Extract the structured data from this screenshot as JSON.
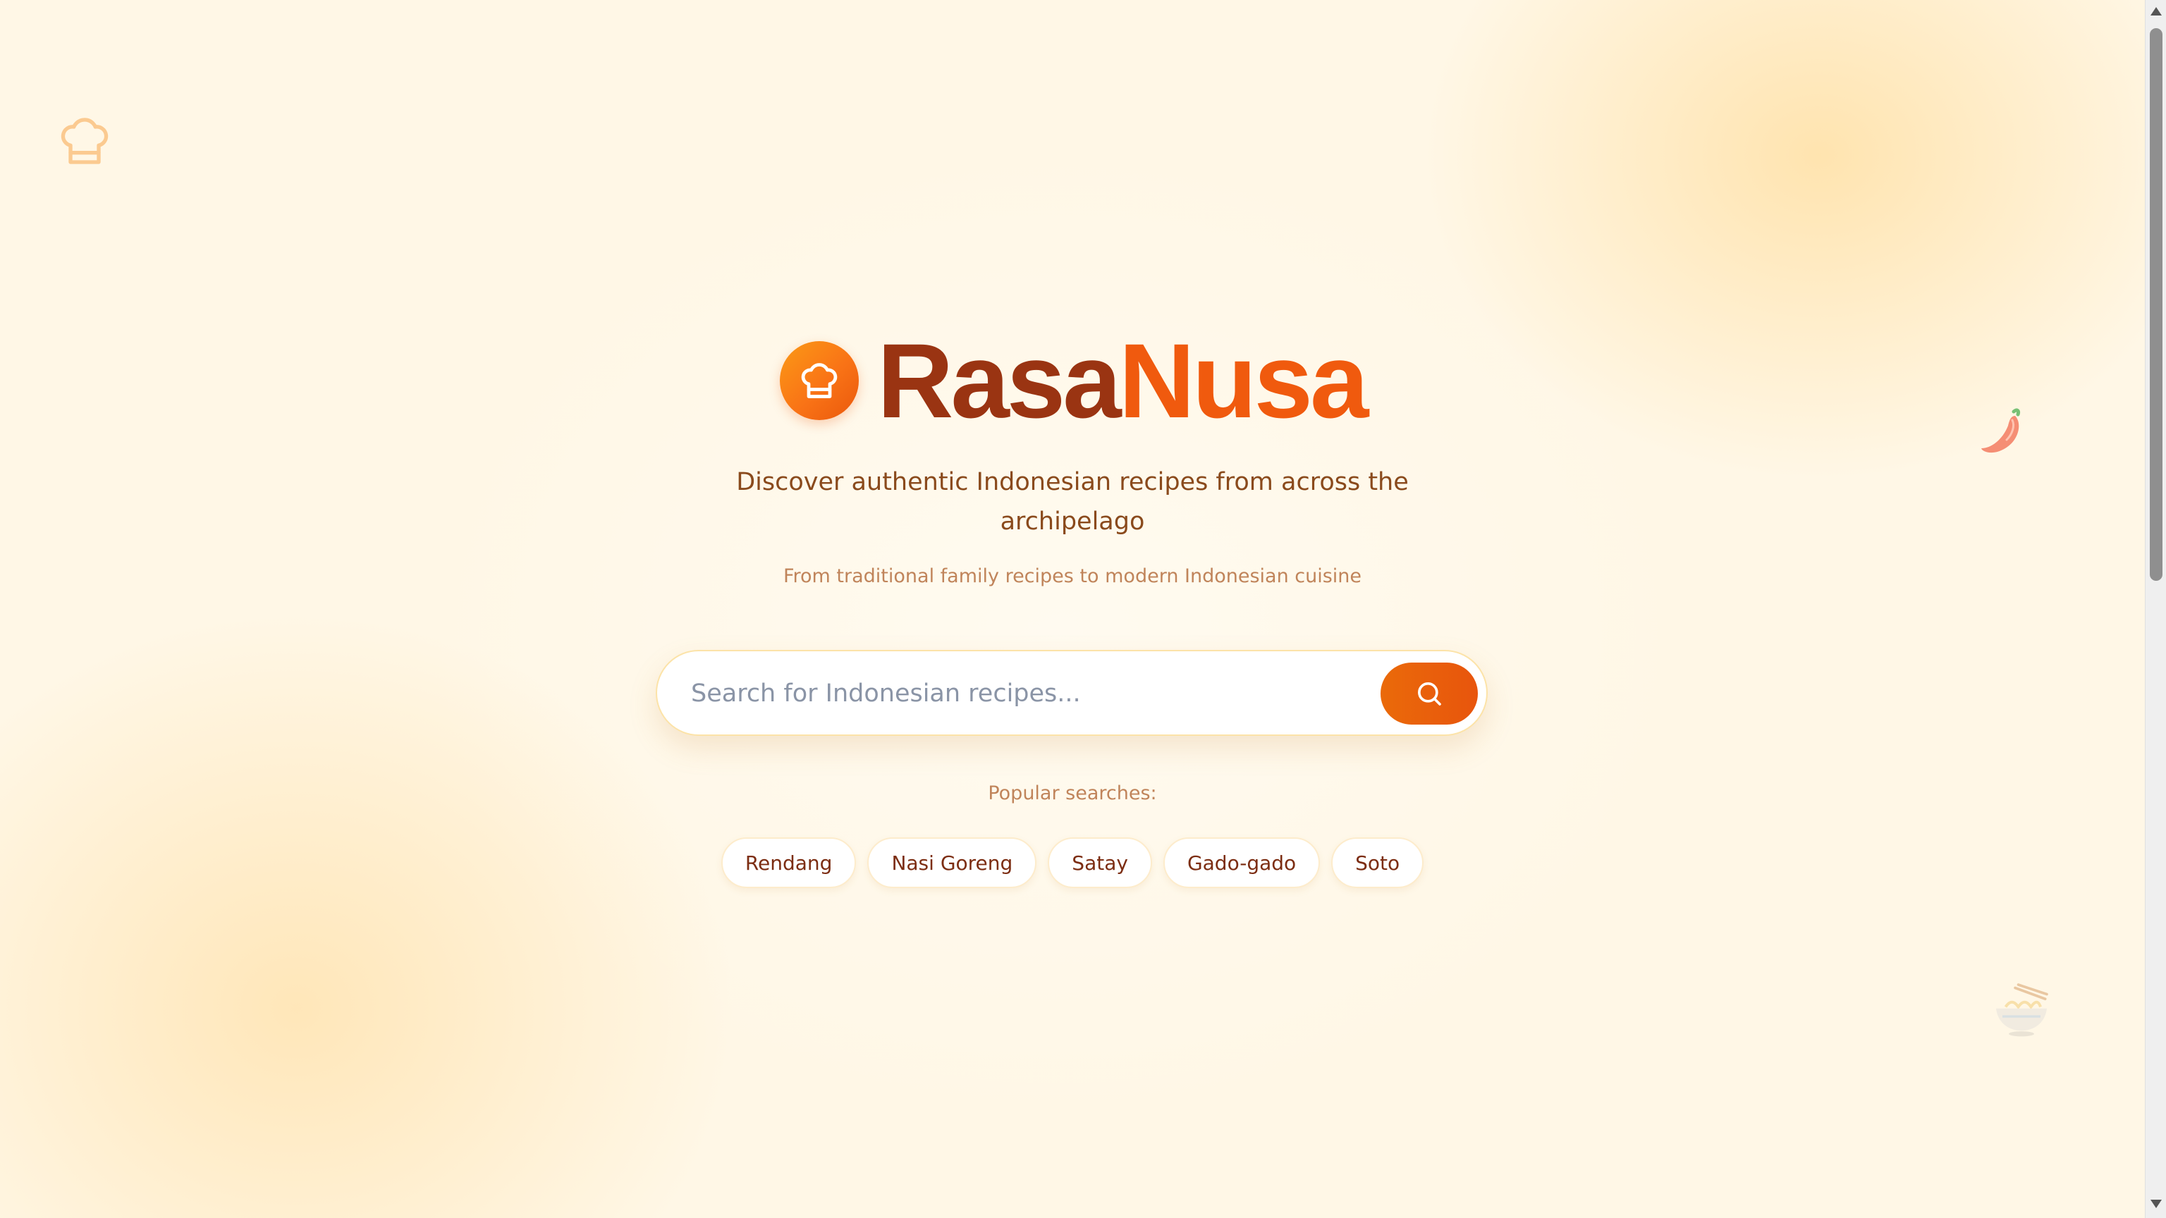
{
  "brand": {
    "name_part1": "Rasa",
    "name_part2": "Nusa",
    "logo_icon": "chef-hat-icon",
    "colors": {
      "rasa": "#9a3412",
      "nusa": "#f05a0e",
      "accent": "#ea580c"
    }
  },
  "hero": {
    "tagline": "Discover authentic Indonesian recipes from across the archipelago",
    "subtagline": "From traditional family recipes to modern Indonesian cuisine"
  },
  "search": {
    "placeholder": "Search for Indonesian recipes...",
    "value": "",
    "button_icon": "search-icon"
  },
  "popular": {
    "label": "Popular searches:",
    "items": [
      "Rendang",
      "Nasi Goreng",
      "Satay",
      "Gado-gado",
      "Soto"
    ]
  },
  "decorations": {
    "top_left_icon": "chef-hat-icon",
    "right_icon": "chili-pepper-icon",
    "bottom_right_icon": "noodle-bowl-icon"
  }
}
